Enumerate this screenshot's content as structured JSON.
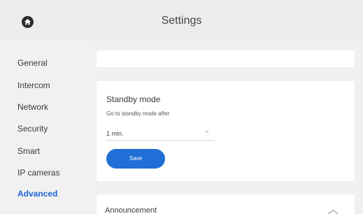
{
  "header": {
    "title": "Settings",
    "home_icon": "home-icon"
  },
  "sidebar": {
    "items": [
      {
        "label": "General"
      },
      {
        "label": "Intercom"
      },
      {
        "label": "Network"
      },
      {
        "label": "Security"
      },
      {
        "label": "Smart"
      },
      {
        "label": "IP cameras"
      },
      {
        "label": "Advanced",
        "active": true
      }
    ]
  },
  "standby": {
    "title": "Standby mode",
    "subtitle": "Go to standby mode after",
    "selected_value": "1 min.",
    "save_label": "Save"
  },
  "announcement": {
    "title": "Announcement"
  },
  "colors": {
    "accent": "#1f6fd6",
    "active_text": "#1f64d6",
    "background": "#f0f0f0",
    "card": "#ffffff"
  }
}
